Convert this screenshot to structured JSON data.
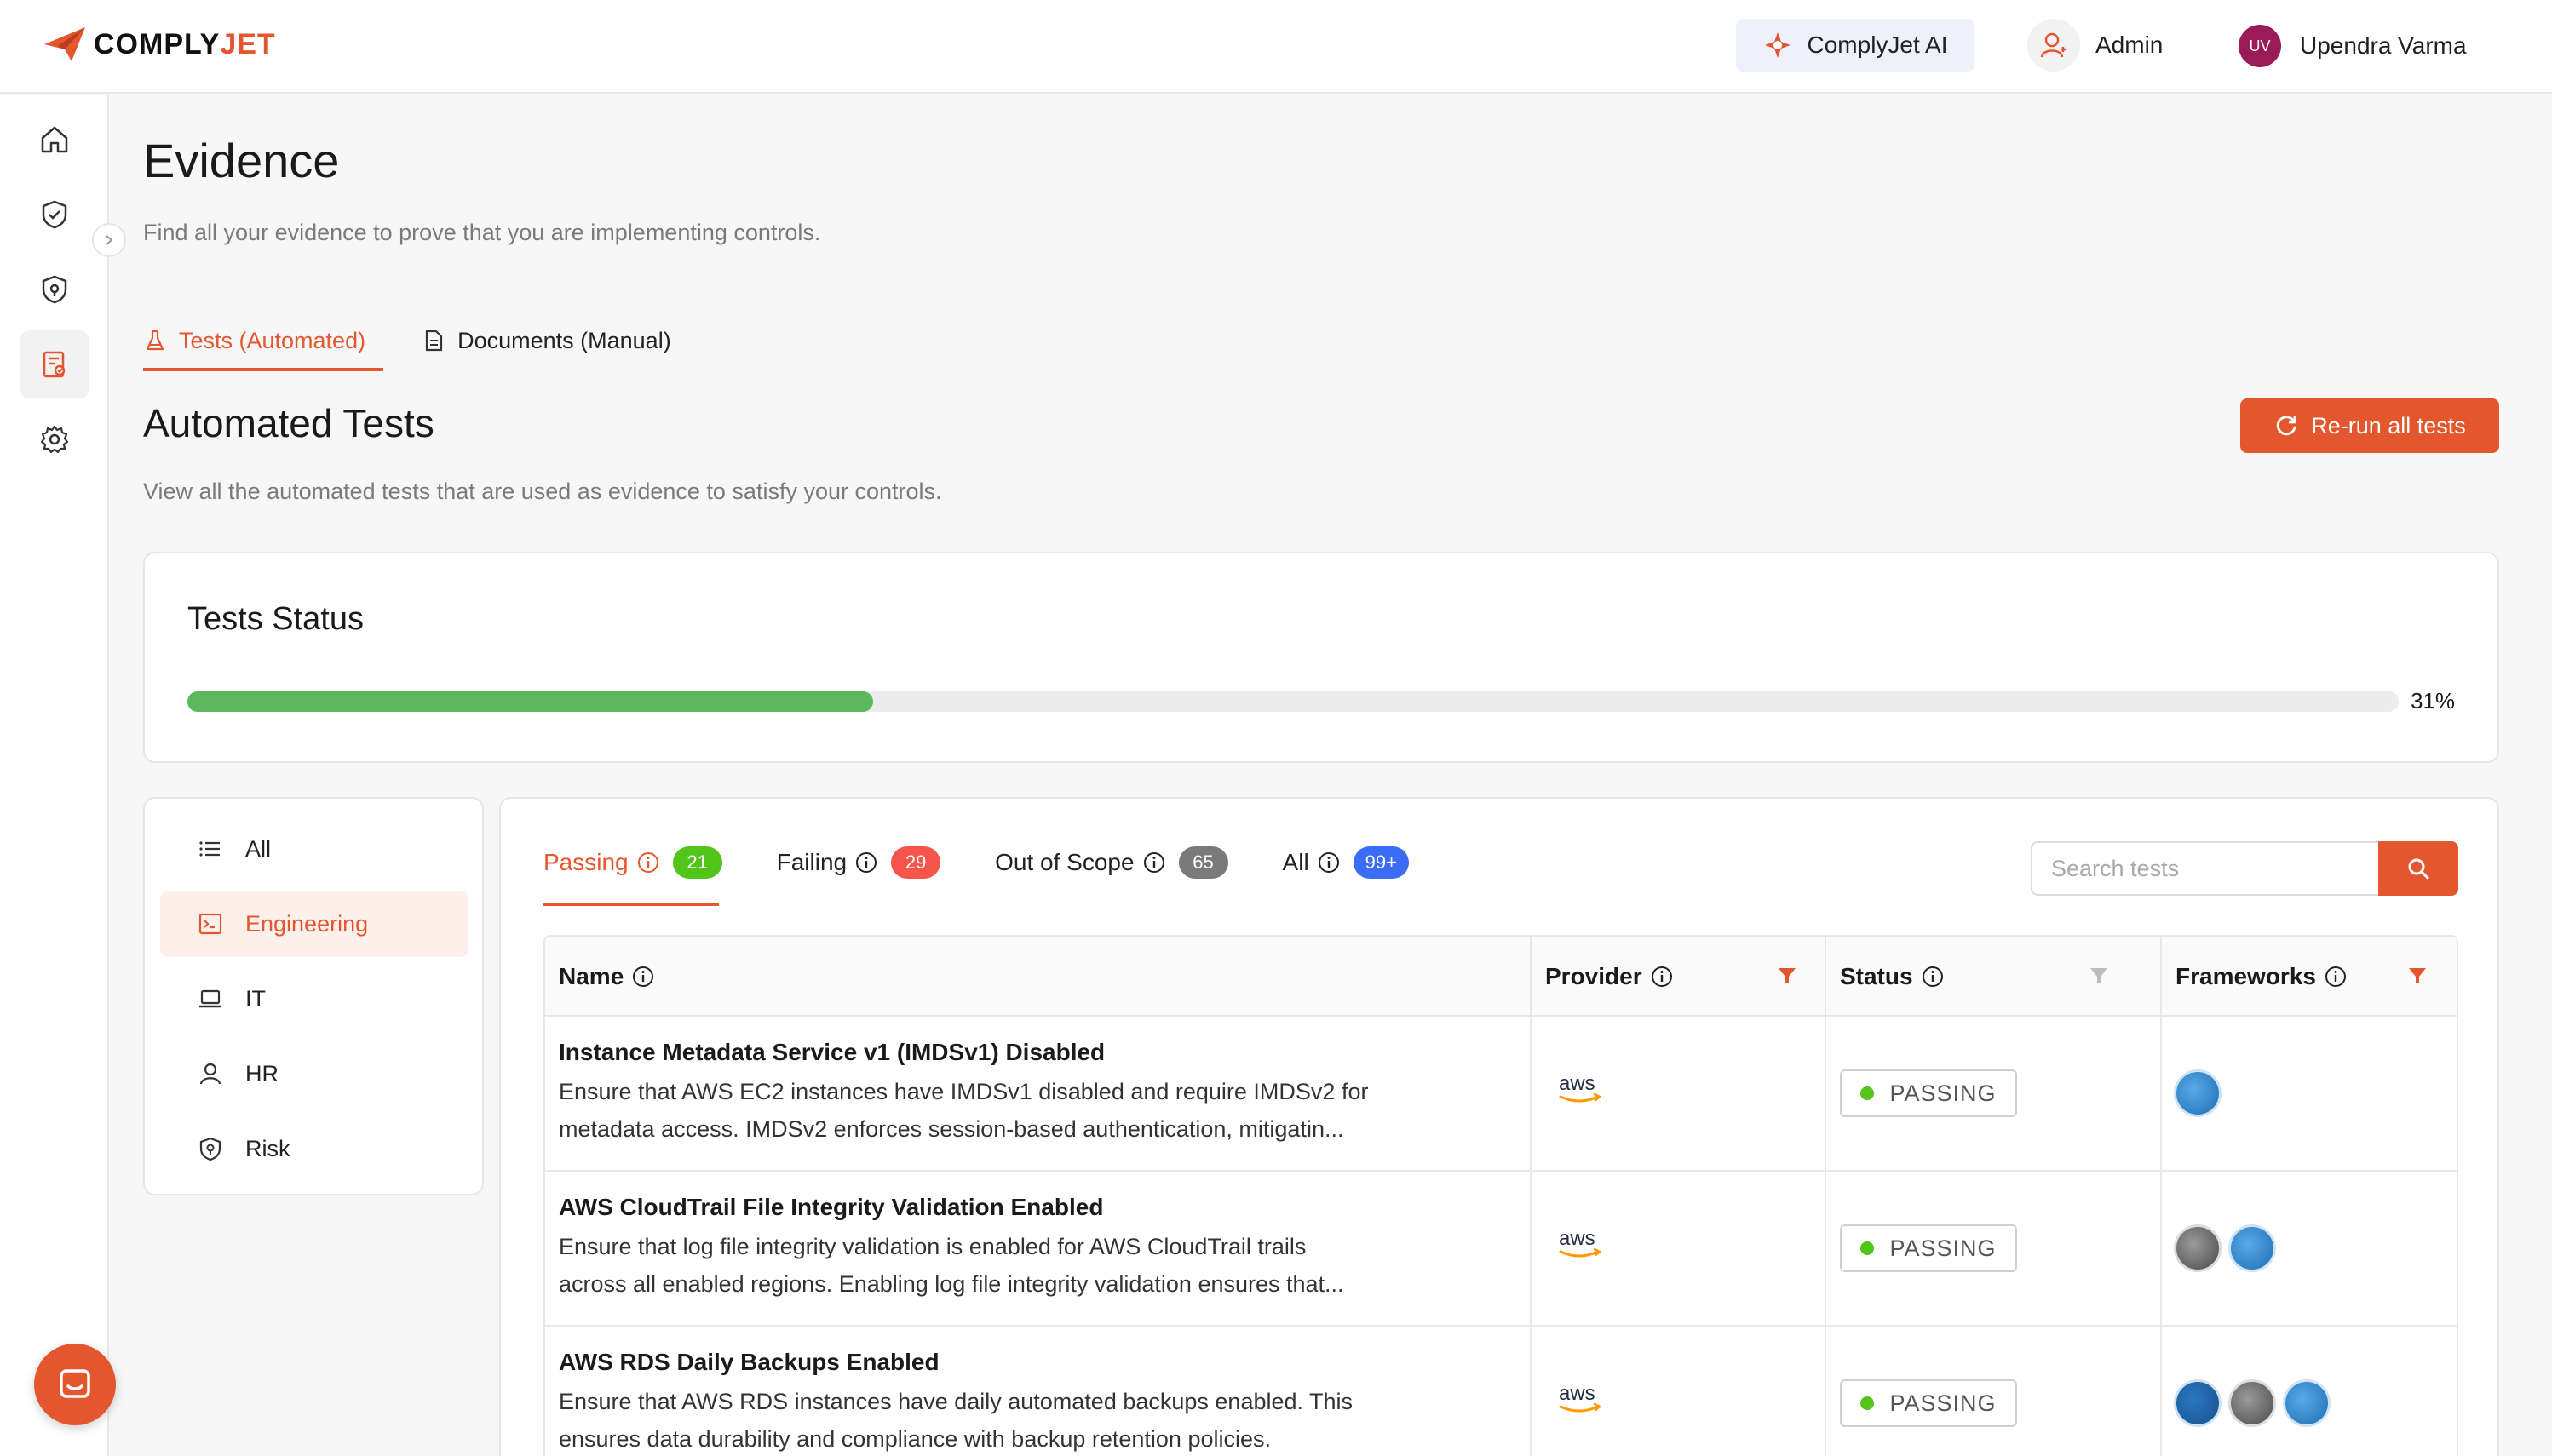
{
  "brand": {
    "name_part1": "COMPLY",
    "name_part2": "JET"
  },
  "header": {
    "ai_button": "ComplyJet AI",
    "role": "Admin",
    "user_initials": "UV",
    "user_name": "Upendra Varma"
  },
  "sidebar": {
    "items": [
      {
        "name": "home-icon"
      },
      {
        "name": "shield-check-icon"
      },
      {
        "name": "policy-shield-icon"
      },
      {
        "name": "evidence-icon",
        "active": true
      },
      {
        "name": "gear-icon"
      }
    ]
  },
  "page": {
    "title": "Evidence",
    "subtitle": "Find all your evidence to prove that you are implementing controls.",
    "tabs": [
      {
        "label": "Tests (Automated)",
        "active": true
      },
      {
        "label": "Documents (Manual)",
        "active": false
      }
    ]
  },
  "section": {
    "title": "Automated Tests",
    "subtitle": "View all the automated tests that are used as evidence to satisfy your controls.",
    "rerun_label": "Re-run all tests"
  },
  "tests_status": {
    "title": "Tests Status",
    "percent": 31,
    "percent_label": "31%"
  },
  "categories": [
    {
      "label": "All",
      "active": false
    },
    {
      "label": "Engineering",
      "active": true
    },
    {
      "label": "IT",
      "active": false
    },
    {
      "label": "HR",
      "active": false
    },
    {
      "label": "Risk",
      "active": false
    }
  ],
  "filters": [
    {
      "label": "Passing",
      "count": "21",
      "color": "#52c41a",
      "active": true
    },
    {
      "label": "Failing",
      "count": "29",
      "color": "#f5554a",
      "active": false
    },
    {
      "label": "Out of Scope",
      "count": "65",
      "color": "#7a7a7a",
      "active": false
    },
    {
      "label": "All",
      "count": "99+",
      "color": "#3b6cf6",
      "active": false
    }
  ],
  "search": {
    "placeholder": "Search tests"
  },
  "table": {
    "columns": [
      "Name",
      "Provider",
      "Status",
      "Frameworks"
    ],
    "rows": [
      {
        "title": "Instance Metadata Service v1 (IMDSv1) Disabled",
        "desc1": "Ensure that AWS EC2 instances have IMDSv1 disabled and require IMDSv2 for",
        "desc2": "metadata access. IMDSv2 enforces session-based authentication, mitigatin...",
        "provider": "aws",
        "status": "PASSING",
        "frameworks": [
          "aicpa"
        ]
      },
      {
        "title": "AWS CloudTrail File Integrity Validation Enabled",
        "desc1": "Ensure that log file integrity validation is enabled for AWS CloudTrail trails",
        "desc2": "across all enabled regions. Enabling log file integrity validation ensures that...",
        "provider": "aws",
        "status": "PASSING",
        "frameworks": [
          "iso",
          "aicpa"
        ]
      },
      {
        "title": "AWS RDS Daily Backups Enabled",
        "desc1": "Ensure that AWS RDS instances have daily automated backups enabled. This",
        "desc2": "ensures data durability and compliance with backup retention policies.",
        "provider": "aws",
        "status": "PASSING",
        "frameworks": [
          "hipaa",
          "iso",
          "aicpa"
        ]
      }
    ]
  },
  "colors": {
    "accent": "#e4572e",
    "progress": "#5cb85c",
    "passing_dot": "#52c41a"
  }
}
